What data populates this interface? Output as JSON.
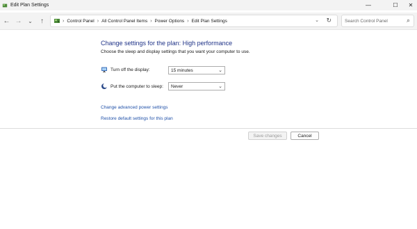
{
  "window": {
    "title": "Edit Plan Settings",
    "controls": {
      "minimize": "—",
      "maximize": "☐",
      "close": "✕"
    }
  },
  "nav": {
    "back_glyph": "←",
    "forward_glyph": "→",
    "recent_glyph": "⌄",
    "up_glyph": "↑"
  },
  "address": {
    "crumbs": [
      "Control Panel",
      "All Control Panel Items",
      "Power Options",
      "Edit Plan Settings"
    ],
    "separator": "›",
    "dropdown_glyph": "⌄",
    "refresh_glyph": "↻"
  },
  "search": {
    "placeholder": "Search Control Panel",
    "icon_glyph": "⌕"
  },
  "content": {
    "heading": "Change settings for the plan: High performance",
    "subtext": "Choose the sleep and display settings that you want your computer to use.",
    "display": {
      "label": "Turn off the display:",
      "value": "15 minutes"
    },
    "sleep": {
      "label": "Put the computer to sleep:",
      "value": "Never"
    },
    "select_arrow": "⌄",
    "advanced_link": "Change advanced power settings",
    "restore_link": "Restore default settings for this plan"
  },
  "buttons": {
    "save": "Save changes",
    "cancel": "Cancel"
  },
  "colors": {
    "heading": "#1e3287",
    "link": "#1f50a8",
    "chrome": "#f3f3f3"
  }
}
